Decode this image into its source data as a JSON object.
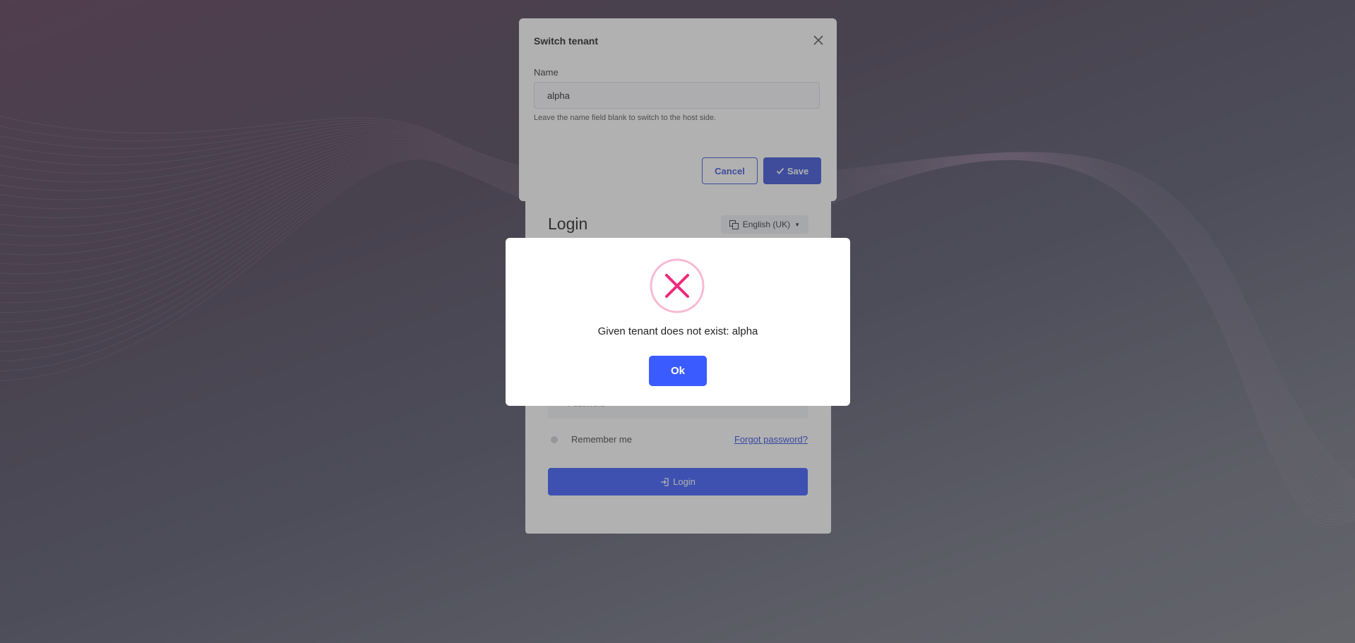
{
  "colors": {
    "accent": "#3a5bff",
    "accent_dark": "#3a52d9",
    "error": "#f0287a",
    "error_ring": "#f9b8d2"
  },
  "login": {
    "title": "Login",
    "language": "English (UK)",
    "language_icon": "translate-icon",
    "password_placeholder": "Password",
    "remember_me": "Remember me",
    "forgot_password": "Forgot password?",
    "login_button": "Login",
    "login_icon": "login-icon"
  },
  "tenant_modal": {
    "title": "Switch tenant",
    "close_icon": "close-icon",
    "name_label": "Name",
    "name_value": "alpha",
    "help_text": "Leave the name field blank to switch to the host side.",
    "cancel_label": "Cancel",
    "save_label": "Save",
    "save_icon": "check-icon"
  },
  "alert": {
    "icon": "error-x-icon",
    "message": "Given tenant does not exist: alpha",
    "ok_label": "Ok"
  }
}
